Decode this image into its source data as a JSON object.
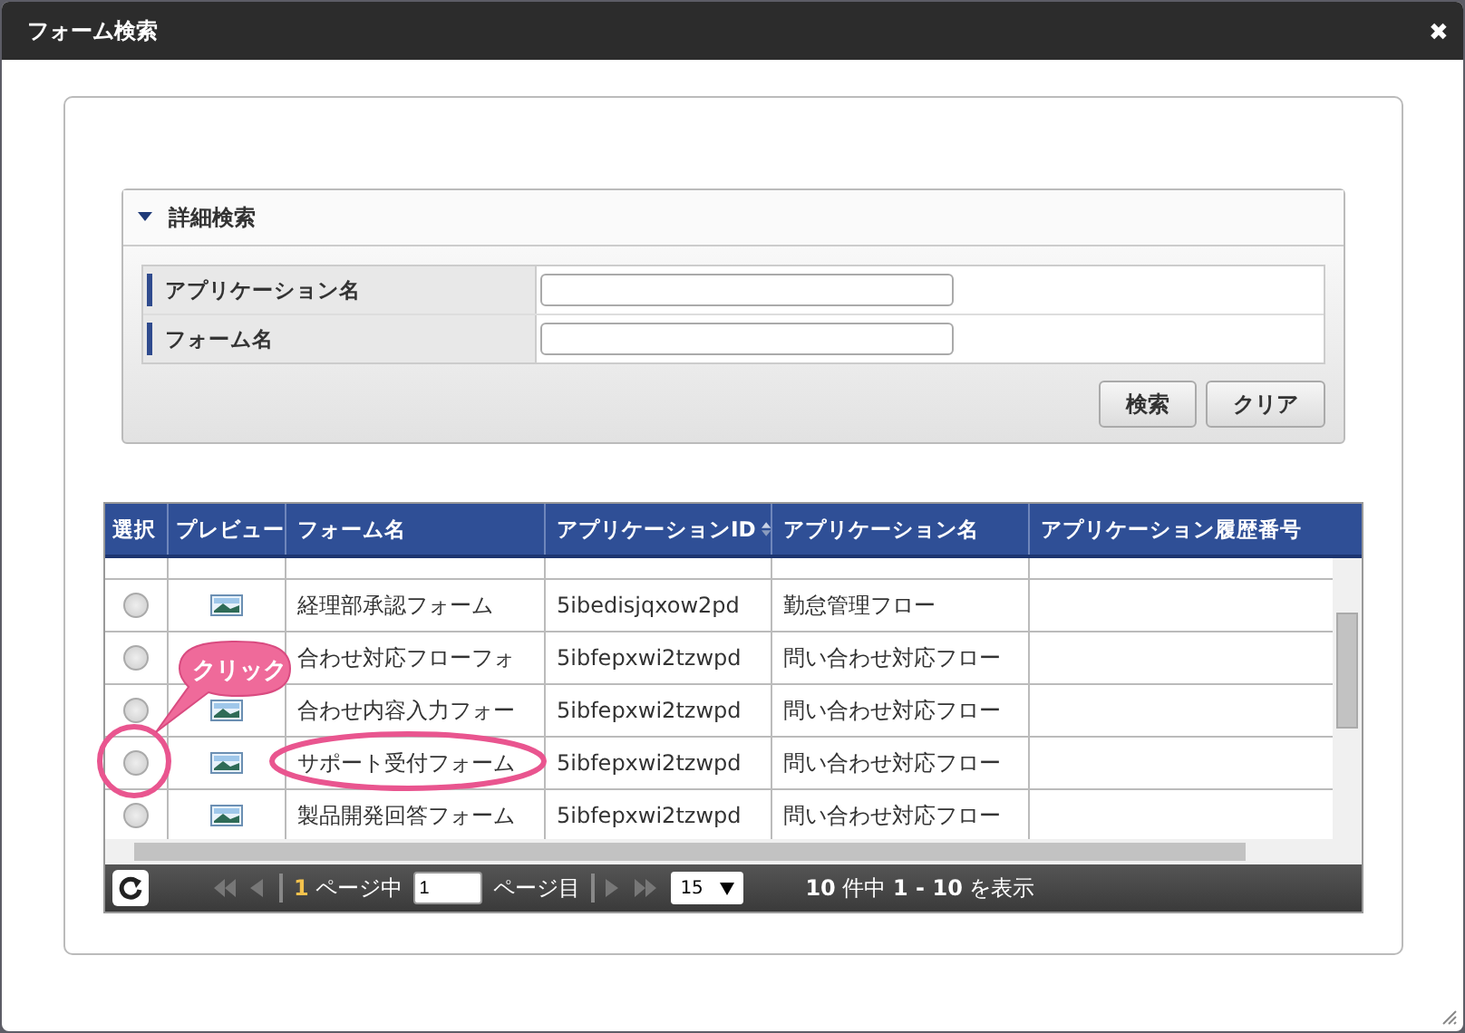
{
  "window": {
    "title": "フォーム検索",
    "close": "✖"
  },
  "search_panel": {
    "title": "詳細検索",
    "expanded": true,
    "fields": [
      {
        "label": "アプリケーション名"
      },
      {
        "label": "フォーム名"
      }
    ],
    "buttons": [
      "検索",
      "クリア"
    ]
  },
  "table": {
    "columns": [
      {
        "label": "選択",
        "sorted": false
      },
      {
        "label": "プレビュー",
        "sorted": false
      },
      {
        "label": "フォーム名",
        "sorted": false
      },
      {
        "label": "アプリケーションID",
        "sorted": true
      },
      {
        "label": "アプリケーション名",
        "sorted": false
      },
      {
        "label": "アプリケーション履歴番号",
        "sorted": false
      }
    ],
    "rows": [
      {
        "selected": false,
        "preview": true,
        "form": "経理部承認フォーム",
        "app_id": "5ibedisjqxow2pd",
        "app_name": "勤怠管理フロー"
      },
      {
        "selected": false,
        "preview": false,
        "form": "合わせ対応フローフォ",
        "app_id": "5ibfepxwi2tzwpd",
        "app_name": "問い合わせ対応フロー"
      },
      {
        "selected": false,
        "preview": true,
        "form": "合わせ内容入力フォー",
        "app_id": "5ibfepxwi2tzwpd",
        "app_name": "問い合わせ対応フロー"
      },
      {
        "selected": false,
        "preview": true,
        "form": "サポート受付フォーム",
        "app_id": "5ibfepxwi2tzwpd",
        "app_name": "問い合わせ対応フロー"
      },
      {
        "selected": false,
        "preview": true,
        "form": "製品開発回答フォーム",
        "app_id": "5ibfepxwi2tzwpd",
        "app_name": "問い合わせ対応フロー"
      }
    ]
  },
  "pager": {
    "current": "1",
    "of_label": "ページ中",
    "page_value": "1",
    "page_suffix": "ページ目",
    "page_size": "15",
    "total": "10",
    "total_label": "件中",
    "range": "1 - 10",
    "range_suffix": "を表示"
  },
  "annotation": {
    "callout": "クリック"
  }
}
